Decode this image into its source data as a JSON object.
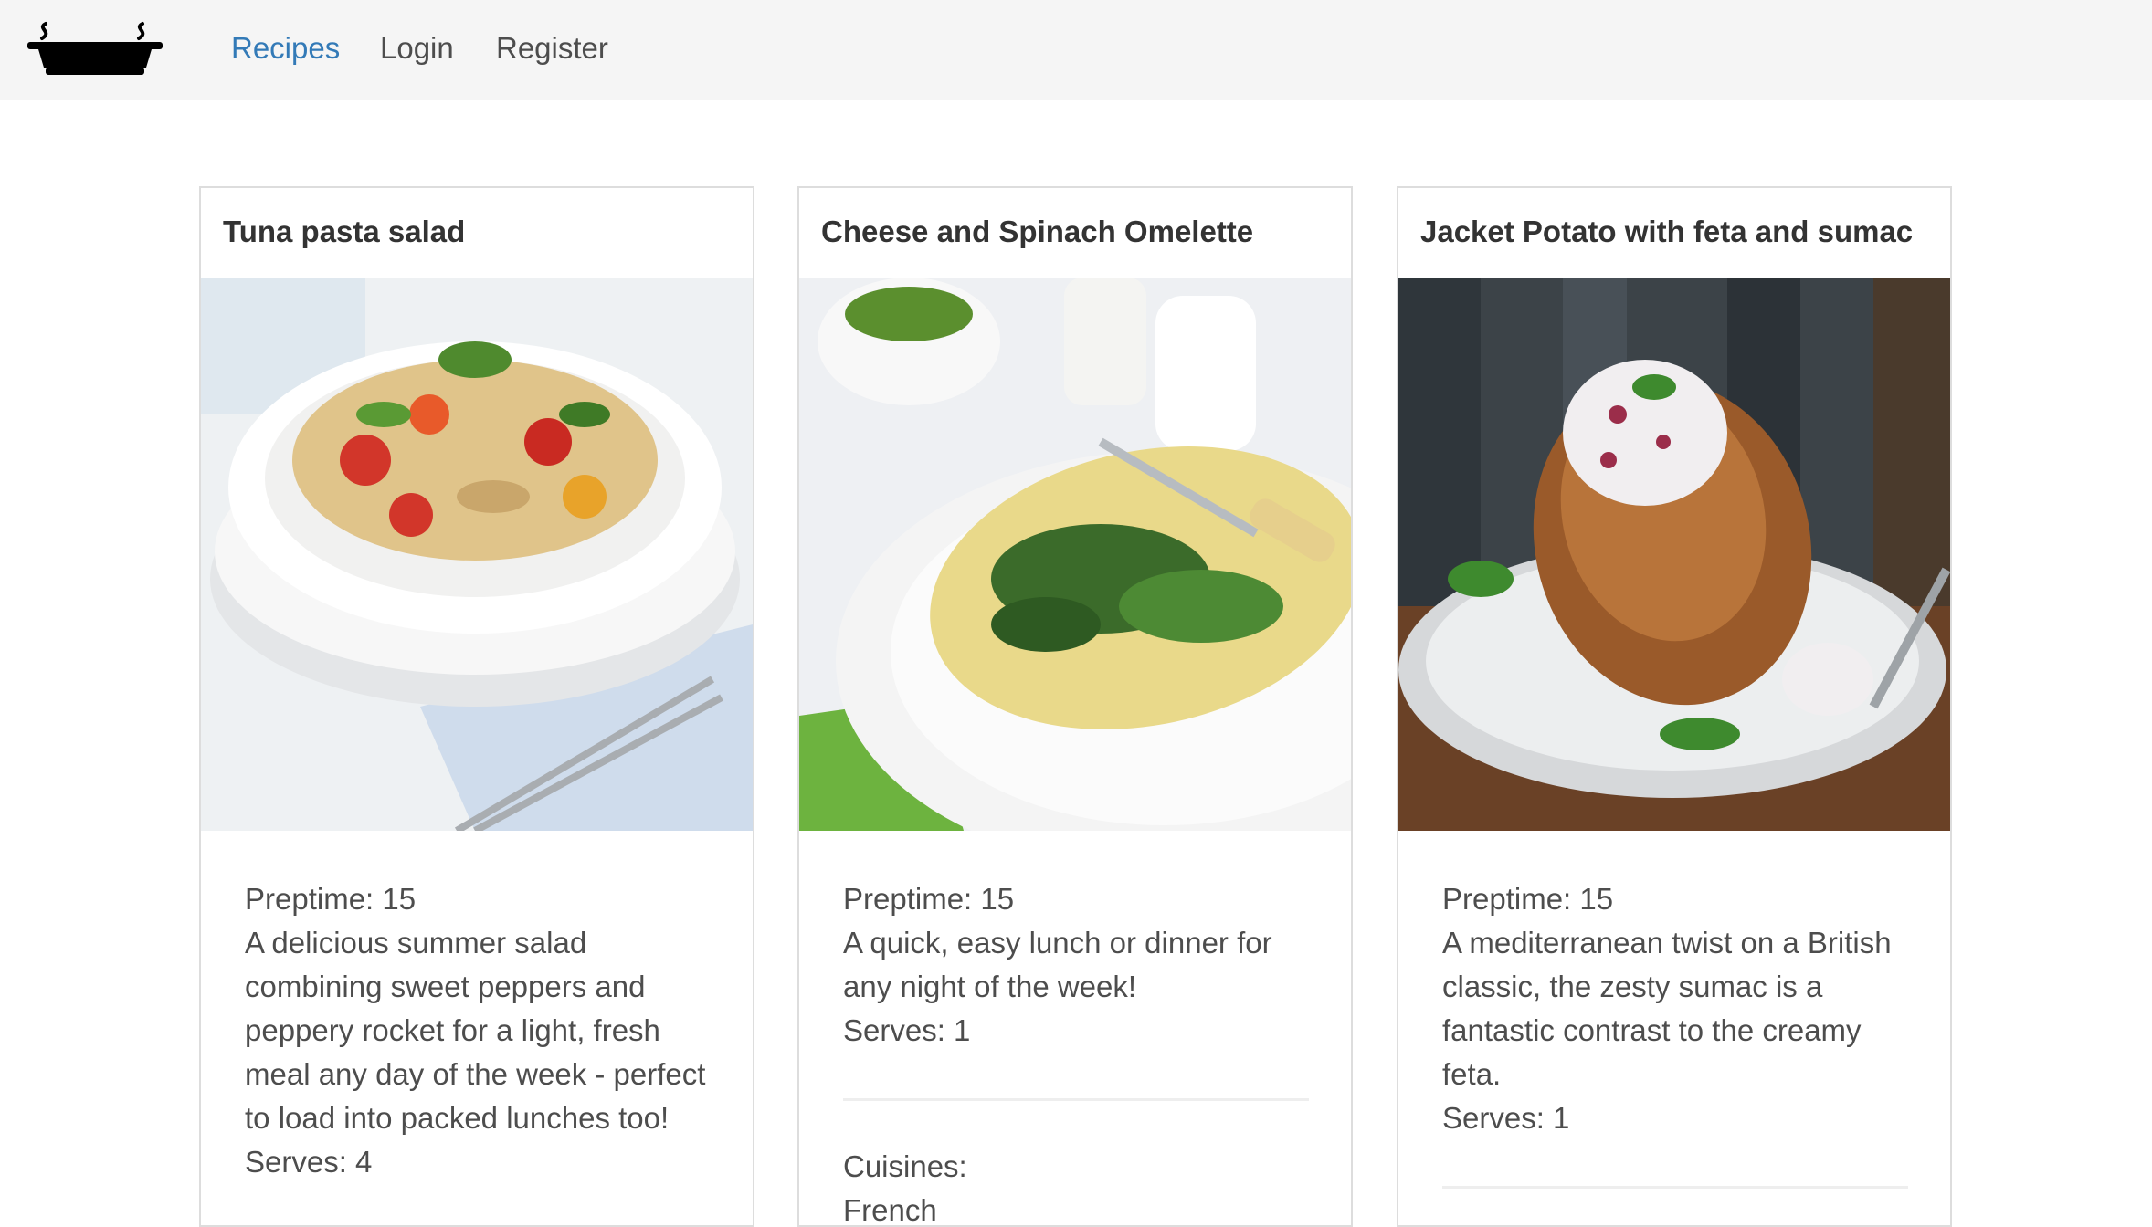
{
  "nav": {
    "brand_icon": "cooking-pot-icon",
    "links": [
      "Recipes",
      "Login",
      "Register"
    ],
    "active_color": "#337ab7"
  },
  "recipes": [
    {
      "title": "Tuna pasta salad",
      "image_icon": "pasta-salad-photo",
      "preptime": "Preptime: 15",
      "description": "A delicious summer salad combining sweet peppers and peppery rocket for a light, fresh meal any day of the week - perfect to load into packed lunches too!",
      "serves": "Serves: 4"
    },
    {
      "title": "Cheese and Spinach Omelette",
      "image_icon": "omelette-photo",
      "preptime": "Preptime: 15",
      "description": "A quick, easy lunch or dinner for any night of the week!",
      "serves": "Serves: 1",
      "cuisines_label": "Cuisines:",
      "cuisine": "French"
    },
    {
      "title": "Jacket Potato with feta and sumac",
      "image_icon": "jacket-potato-photo",
      "preptime": "Preptime: 15",
      "description": "A mediterranean twist on a British classic, the zesty sumac is a fantastic contrast to the creamy feta.",
      "serves": "Serves: 1"
    }
  ]
}
